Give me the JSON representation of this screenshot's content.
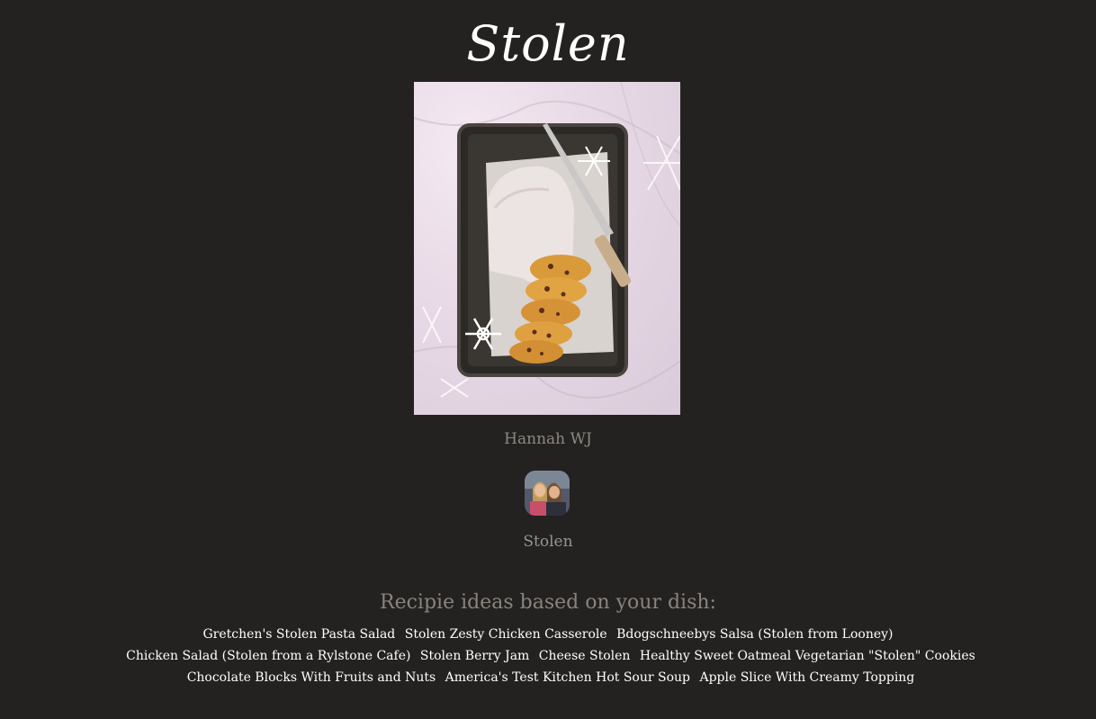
{
  "recipe": {
    "title": "Stolen",
    "image_alt": "Stolen",
    "author": "Hannah WJ",
    "dish_name": "Stolen"
  },
  "ideas": {
    "heading": "Recipie ideas based on your dish:",
    "links": [
      "Gretchen's Stolen Pasta Salad",
      "Stolen Zesty Chicken Casserole",
      "Bdogschneebys Salsa (Stolen from Looney)",
      "Chicken Salad (Stolen from a Rylstone Cafe)",
      "Stolen Berry Jam",
      "Cheese Stolen",
      "Healthy Sweet Oatmeal Vegetarian \"Stolen\" Cookies",
      "Chocolate Blocks With Fruits and Nuts",
      "America's Test Kitchen Hot Sour Soup",
      "Apple Slice With Creamy Topping"
    ]
  },
  "colors": {
    "background": "#232221",
    "muted_text": "#8e8781",
    "link_text": "#ffffff"
  }
}
